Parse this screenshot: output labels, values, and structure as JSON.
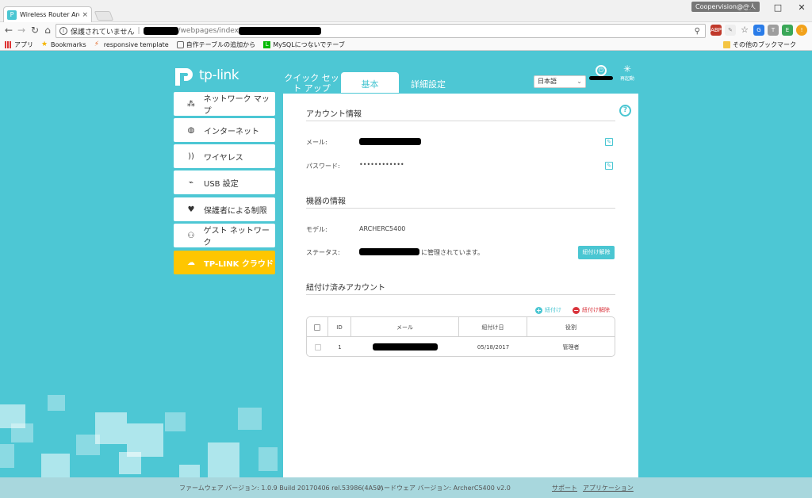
{
  "browser": {
    "tab_title": "Wireless Router Archer C",
    "tab_close": "×",
    "user_badge": "Coopervision@@人",
    "window_controls": [
      "—",
      "□",
      "✕"
    ],
    "security_text": "保護されていません",
    "url_visible": "/webpages/index",
    "bookmarks": [
      {
        "icon": "apps-grid-icon",
        "label": "アプリ"
      },
      {
        "icon": "star-icon",
        "label": "Bookmarks"
      },
      {
        "icon": "leaf-icon",
        "label": "responsive template"
      },
      {
        "icon": "extension-icon",
        "label": "自作テーブルの追加から"
      },
      {
        "icon": "line-l-icon",
        "label": "MySQLにつないでテーブ"
      }
    ],
    "other_bookmarks": "その他のブックマーク"
  },
  "router": {
    "logo_text": "tp-link",
    "tabs": [
      {
        "label": "クイック セット アップ",
        "active": false
      },
      {
        "label": "基本",
        "active": true
      },
      {
        "label": "詳細設定",
        "active": false
      }
    ],
    "language": "日本語",
    "reboot_label": "再起動",
    "sidebar": [
      {
        "icon": "network-map-icon",
        "label": "ネットワーク マップ",
        "active": false
      },
      {
        "icon": "globe-icon",
        "label": "インターネット",
        "active": false
      },
      {
        "icon": "wifi-icon",
        "label": "ワイヤレス",
        "active": false
      },
      {
        "icon": "usb-icon",
        "label": "USB 設定",
        "active": false
      },
      {
        "icon": "heart-hands-icon",
        "label": "保護者による制限",
        "active": false
      },
      {
        "icon": "guest-network-icon",
        "label": "ゲスト ネットワーク",
        "active": false
      },
      {
        "icon": "cloud-icon",
        "label": "TP-LINK クラウド",
        "active": true
      }
    ],
    "account": {
      "title": "アカウント情報",
      "email_label": "メール:",
      "password_label": "パスワード:",
      "password_value": "••••••••••••"
    },
    "device": {
      "title": "機器の情報",
      "model_label": "モデル:",
      "model_value": "ARCHERC5400",
      "status_label": "ステータス:",
      "status_suffix": "に管理されています。",
      "unbind_button": "紐付け解除"
    },
    "bound_accounts": {
      "title": "紐付け済みアカウント",
      "add_label": "紐付け",
      "remove_label": "紐付け解除",
      "columns": [
        "ID",
        "メール",
        "紐付け日",
        "役割"
      ],
      "rows": [
        {
          "id": "1",
          "date": "05/18/2017",
          "role": "管理者"
        }
      ]
    },
    "footer": {
      "firmware": "ファームウェア バージョン: 1.0.9 Build 20170406 rel.53986(4A50)",
      "hardware": "ハードウェア バージョン: ArcherC5400 v2.0",
      "support": "サポート",
      "app": "アプリケーション"
    }
  },
  "colors": {
    "accent": "#4ac6d2",
    "background": "#4dc7d4",
    "active_sidebar": "#ffc600",
    "remove_red": "#d9343c"
  }
}
